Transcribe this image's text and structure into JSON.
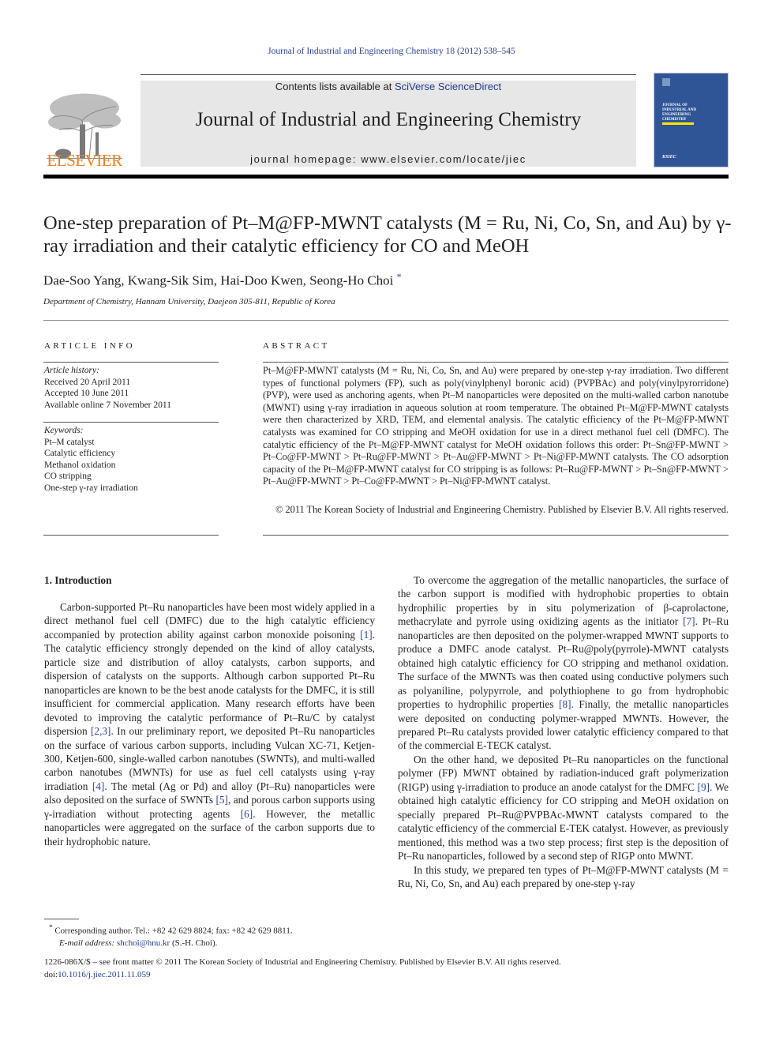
{
  "journal_ref": "Journal of Industrial and Engineering Chemistry 18 (2012) 538–545",
  "header": {
    "contents_prefix": "Contents lists available at ",
    "contents_link": "SciVerse ScienceDirect",
    "journal_name": "Journal of Industrial and Engineering Chemistry",
    "homepage": "journal homepage: www.elsevier.com/locate/jiec",
    "publisher_logo_text": "ELSEVIER",
    "cover_title_lines": [
      "JOURNAL OF",
      "INDUSTRIAL AND",
      "ENGINEERING",
      "CHEMISTRY"
    ],
    "cover_society": "KSIEC"
  },
  "article": {
    "title": "One-step preparation of Pt–M@FP-MWNT catalysts (M = Ru, Ni, Co, Sn, and Au) by γ-ray irradiation and their catalytic efficiency for CO and MeOH",
    "authors": "Dae-Soo Yang, Kwang-Sik Sim, Hai-Doo Kwen, Seong-Ho Choi",
    "author_mark": "*",
    "affiliation": "Department of Chemistry, Hannam University, Daejeon 305-811, Republic of Korea"
  },
  "article_info": {
    "heading": "ARTICLE INFO",
    "history_label": "Article history:",
    "history": [
      "Received 20 April 2011",
      "Accepted 10 June 2011",
      "Available online 7 November 2011"
    ],
    "keywords_label": "Keywords:",
    "keywords": [
      "Pt–M catalyst",
      "Catalytic efficiency",
      "Methanol oxidation",
      "CO stripping",
      "One-step γ-ray irradiation"
    ]
  },
  "abstract": {
    "heading": "ABSTRACT",
    "text": "Pt–M@FP-MWNT catalysts (M = Ru, Ni, Co, Sn, and Au) were prepared by one-step γ-ray irradiation. Two different types of functional polymers (FP), such as poly(vinylphenyl boronic acid) (PVPBAc) and poly(vinylpyrorridone) (PVP), were used as anchoring agents, when Pt–M nanoparticles were deposited on the multi-walled carbon nanotube (MWNT) using γ-ray irradiation in aqueous solution at room temperature. The obtained Pt–M@FP-MWNT catalysts were then characterized by XRD, TEM, and elemental analysis. The catalytic efficiency of the Pt–M@FP-MWNT catalysts was examined for CO stripping and MeOH oxidation for use in a direct methanol fuel cell (DMFC). The catalytic efficiency of the Pt–M@FP-MWNT catalyst for MeOH oxidation follows this order: Pt–Sn@FP-MWNT > Pt–Co@FP-MWNT > Pt–Ru@FP-MWNT > Pt–Au@FP-MWNT > Pt–Ni@FP-MWNT catalysts. The CO adsorption capacity of the Pt–M@FP-MWNT catalyst for CO stripping is as follows: Pt–Ru@FP-MWNT > Pt–Sn@FP-MWNT > Pt–Au@FP-MWNT > Pt–Co@FP-MWNT > Pt–Ni@FP-MWNT catalyst.",
    "copyright": "© 2011 The Korean Society of Industrial and Engineering Chemistry. Published by Elsevier B.V. All rights reserved."
  },
  "body": {
    "section_heading": "1.  Introduction",
    "left": {
      "p1": [
        "Carbon-supported Pt–Ru nanoparticles have been most widely applied in a direct methanol fuel cell (DMFC) due to the high catalytic efficiency accompanied by protection ability against carbon monoxide poisoning ",
        "[1]",
        ". The catalytic efficiency strongly depended on the kind of alloy catalysts, particle size and distribution of alloy catalysts, carbon supports, and dispersion of catalysts on the supports. Although carbon supported Pt–Ru nanoparticles are known to be the best anode catalysts for the DMFC, it is still insufficient for commercial application. Many research efforts have been devoted to improving the catalytic performance of Pt–Ru/C by catalyst dispersion ",
        "[2,3]",
        ". In our preliminary report, we deposited Pt–Ru nanoparticles on the surface of various carbon supports, including Vulcan XC-71, Ketjen-300, Ketjen-600, single-walled carbon nanotubes (SWNTs), and multi-walled carbon nanotubes (MWNTs) for use as fuel cell catalysts using γ-ray irradiation ",
        "[4]",
        ". The metal (Ag or Pd) and alloy (Pt–Ru) nanoparticles were also deposited on the surface of SWNTs ",
        "[5]",
        ", and porous carbon supports using γ-irradiation without protecting agents ",
        "[6]",
        ". However, the metallic nanoparticles were aggregated on the surface of the carbon supports due to their hydrophobic nature."
      ]
    },
    "right": {
      "p1": [
        "To overcome the aggregation of the metallic nanoparticles, the surface of the carbon support is modified with hydrophobic properties to obtain hydrophilic properties by in situ polymerization of β-caprolactone, methacrylate and pyrrole using oxidizing agents as the initiator ",
        "[7]",
        ". Pt–Ru nanoparticles are then deposited on the polymer-wrapped MWNT supports to produce a DMFC anode catalyst. Pt–Ru@poly(pyrrole)-MWNT catalysts obtained high catalytic efficiency for CO stripping and methanol oxidation. The surface of the MWNTs was then coated using conductive polymers such as polyaniline, polypyrrole, and polythiophene to go from hydrophobic properties to hydrophilic properties ",
        "[8]",
        ". Finally, the metallic nanoparticles were deposited on conducting polymer-wrapped MWNTs. However, the prepared Pt–Ru catalysts provided lower catalytic efficiency compared to that of the commercial E-TECK catalyst."
      ],
      "p2": [
        "On the other hand, we deposited Pt–Ru nanoparticles on the functional polymer (FP) MWNT obtained by radiation-induced graft polymerization (RIGP) using γ-irradiation to produce an anode catalyst for the DMFC ",
        "[9]",
        ". We obtained high catalytic efficiency for CO stripping and MeOH oxidation on specially prepared Pt–Ru@PVPBAc-MWNT catalysts compared to the catalytic efficiency of the commercial E-TEK catalyst. However, as previously mentioned, this method was a two step process; first step is the deposition of Pt–Ru nanoparticles, followed by a second step of RIGP onto MWNT."
      ],
      "p3": "In this study, we prepared ten types of Pt–M@FP-MWNT catalysts (M = Ru, Ni, Co, Sn, and Au) each prepared by one-step γ-ray"
    }
  },
  "footnote": {
    "mark": "*",
    "line1": "Corresponding author. Tel.: +82 42 629 8824; fax: +82 42 629 8811.",
    "email_label": "E-mail address:",
    "email": "shchoi@hnu.kr",
    "email_suffix": " (S.-H. Choi)."
  },
  "front_matter": {
    "line1": "1226-086X/$ – see front matter © 2011 The Korean Society of Industrial and Engineering Chemistry. Published by Elsevier B.V. All rights reserved.",
    "doi_label": "doi:",
    "doi": "10.1016/j.jiec.2011.11.059"
  }
}
